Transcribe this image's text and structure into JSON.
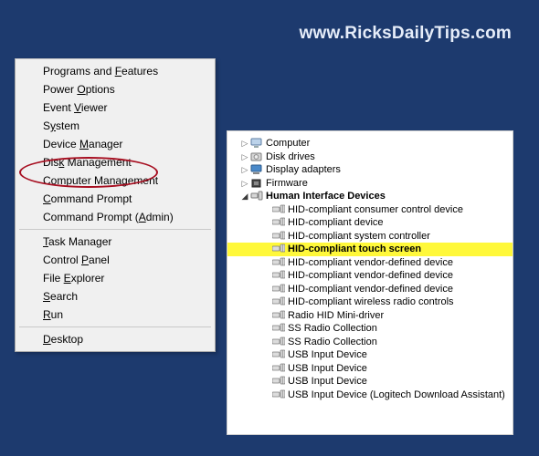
{
  "watermark": "www.RicksDailyTips.com",
  "ctx_menu": {
    "groups": [
      [
        {
          "pre": "Programs and ",
          "m": "F",
          "post": "eatures"
        },
        {
          "pre": "Power ",
          "m": "O",
          "post": "ptions"
        },
        {
          "pre": "Event ",
          "m": "V",
          "post": "iewer"
        },
        {
          "pre": "S",
          "m": "y",
          "post": "stem"
        },
        {
          "pre": "Device ",
          "m": "M",
          "post": "anager"
        },
        {
          "pre": "Dis",
          "m": "k",
          "post": " Management"
        },
        {
          "pre": "Computer Mana",
          "m": "g",
          "post": "ement"
        },
        {
          "pre": "",
          "m": "C",
          "post": "ommand Prompt"
        },
        {
          "pre": "Command Prompt (",
          "m": "A",
          "post": "dmin)"
        }
      ],
      [
        {
          "pre": "",
          "m": "T",
          "post": "ask Manager"
        },
        {
          "pre": "Control ",
          "m": "P",
          "post": "anel"
        },
        {
          "pre": "File ",
          "m": "E",
          "post": "xplorer"
        },
        {
          "pre": "",
          "m": "S",
          "post": "earch"
        },
        {
          "pre": "",
          "m": "R",
          "post": "un"
        }
      ],
      [
        {
          "pre": "",
          "m": "D",
          "post": "esktop"
        }
      ]
    ],
    "highlighted_index": 4
  },
  "device_tree": {
    "categories": [
      {
        "label": "Computer",
        "expanded": false,
        "icon": "computer-icon"
      },
      {
        "label": "Disk drives",
        "expanded": false,
        "icon": "disk-icon"
      },
      {
        "label": "Display adapters",
        "expanded": false,
        "icon": "display-icon"
      },
      {
        "label": "Firmware",
        "expanded": false,
        "icon": "firmware-icon"
      },
      {
        "label": "Human Interface Devices",
        "expanded": true,
        "icon": "hid-icon",
        "children": [
          {
            "label": "HID-compliant consumer control device",
            "hl": false
          },
          {
            "label": "HID-compliant device",
            "hl": false
          },
          {
            "label": "HID-compliant system controller",
            "hl": false
          },
          {
            "label": "HID-compliant touch screen",
            "hl": true
          },
          {
            "label": "HID-compliant vendor-defined device",
            "hl": false
          },
          {
            "label": "HID-compliant vendor-defined device",
            "hl": false
          },
          {
            "label": "HID-compliant vendor-defined device",
            "hl": false
          },
          {
            "label": "HID-compliant wireless radio controls",
            "hl": false
          },
          {
            "label": "Radio HID Mini-driver",
            "hl": false
          },
          {
            "label": "SS Radio Collection",
            "hl": false
          },
          {
            "label": "SS Radio Collection",
            "hl": false
          },
          {
            "label": "USB Input Device",
            "hl": false
          },
          {
            "label": "USB Input Device",
            "hl": false
          },
          {
            "label": "USB Input Device",
            "hl": false
          },
          {
            "label": "USB Input Device (Logitech Download Assistant)",
            "hl": false
          }
        ]
      }
    ]
  },
  "colors": {
    "background": "#1d3a6e",
    "highlight": "#fff83a",
    "ellipse": "#a70f21"
  }
}
